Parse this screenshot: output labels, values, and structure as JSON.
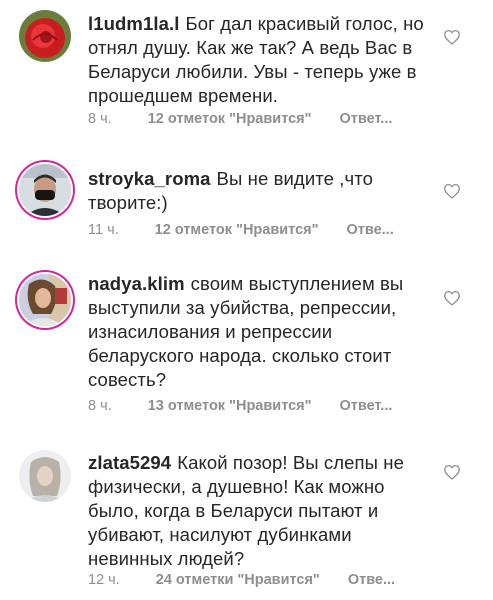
{
  "comments": [
    {
      "username": "l1udm1la.l",
      "text": "Бог дал красивый голос, но отнял душу. Как же так? А ведь Вас в Беларуси любили. Увы - теперь уже в прошедшем времени.",
      "time": "8 ч.",
      "likes": "12 отметок \"Нравится\"",
      "reply": "Ответ...",
      "avatar": "rose-photo"
    },
    {
      "username": "stroyka_roma",
      "text": "Вы не видите ,что творите:)",
      "time": "11 ч.",
      "likes": "12 отметок \"Нравится\"",
      "reply": "Отве...",
      "avatar": "masked-person-photo"
    },
    {
      "username": "nadya.klim",
      "text": "своим выступлением вы выступили за убийства, репрессии, изнасилования и репрессии беларуского народа. сколько стоит совесть?",
      "time": "8 ч.",
      "likes": "13 отметок \"Нравится\"",
      "reply": "Ответ...",
      "avatar": "woman-photo"
    },
    {
      "username": "zlata5294",
      "text": "Какой позор! Вы слепы не физически, а душевно! Как можно было, когда в Беларуси пытают и убивают, насилуют дубинками невинных людей?",
      "time": "12 ч.",
      "likes": "24 отметки \"Нравится\"",
      "reply": "Отве...",
      "avatar": "woman-photo-light"
    }
  ],
  "icons": {
    "like": "heart-outline-icon"
  },
  "colors": {
    "text": "#262626",
    "meta": "#8e8e8e",
    "story_ring": "#d6249f"
  }
}
